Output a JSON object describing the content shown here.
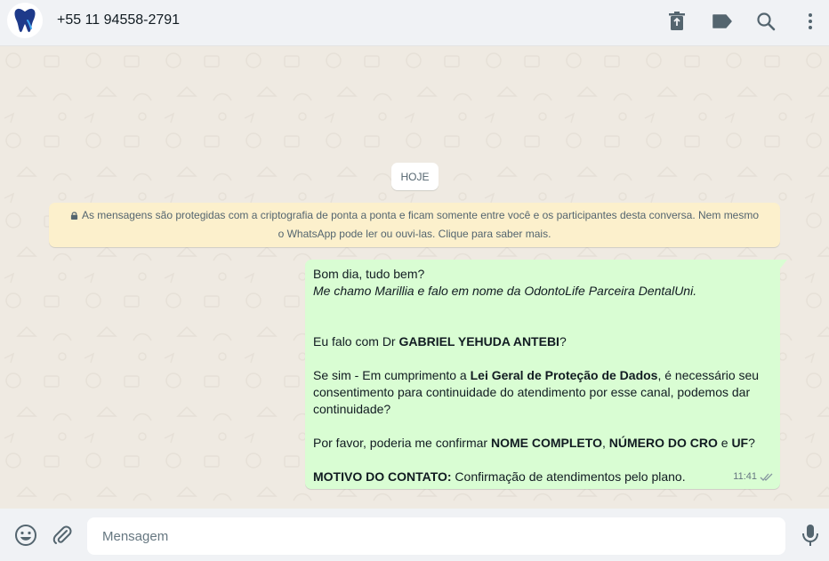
{
  "header": {
    "contact_name": "+55 11 94558-2791",
    "icons": [
      "delete-icon",
      "label-icon",
      "search-icon",
      "menu-icon"
    ]
  },
  "chat": {
    "date_chip": "HOJE",
    "e2e_line1": "As mensagens são protegidas com a criptografia de ponta a ponta e ficam somente entre você e os participantes desta conversa. Nem mesmo",
    "e2e_line2": "o WhatsApp pode ler ou ouvi-las. Clique para saber mais.",
    "message": {
      "greeting": "Bom dia, tudo bem?",
      "intro": "Me chamo Marillia e falo em nome da OdontoLife Parceira DentalUni.",
      "q_prefix": "Eu falo com Dr ",
      "q_name": "GABRIEL YEHUDA ANTEBI",
      "q_suffix": "?",
      "lgpd_prefix": "Se sim - Em cumprimento a ",
      "lgpd_bold": "Lei Geral de Proteção de Dados",
      "lgpd_suffix": ", é necessário seu consentimento para continuidade do atendimento por esse canal, podemos dar continuidade?",
      "confirm_prefix": "Por favor, poderia me confirmar ",
      "confirm_b1": "NOME COMPLETO",
      "confirm_sep1": ", ",
      "confirm_b2": "NÚMERO DO CRO",
      "confirm_sep2": " e ",
      "confirm_b3": "UF",
      "confirm_suffix": "?",
      "motivo_label": "MOTIVO DO CONTATO:",
      "motivo_text": " Confirmação de atendimentos pelo plano.",
      "time": "11:41"
    }
  },
  "footer": {
    "placeholder": "Mensagem",
    "icons": [
      "emoji-icon",
      "attach-icon",
      "mic-icon"
    ]
  },
  "colors": {
    "header_bg": "#f0f2f5",
    "chat_bg": "#efeae2",
    "outgoing_bubble": "#d9fdd3",
    "notice_bg": "#fcf0cc",
    "brand_logo": "#1e3a8a"
  }
}
